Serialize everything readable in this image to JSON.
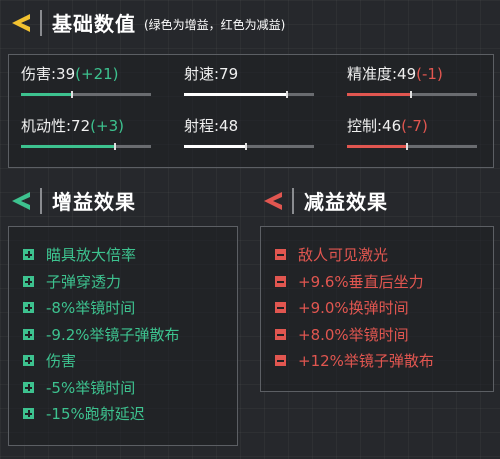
{
  "header": {
    "title": "基础数值",
    "subtitle": "(绿色为增益，红色为减益)"
  },
  "colors": {
    "positive": "#3dc28f",
    "negative": "#e15650",
    "neutral": "#ffffff",
    "accent_yellow": "#f2c230"
  },
  "stats": [
    {
      "label": "伤害:39",
      "delta": "(+21)",
      "delta_type": "positive",
      "fill_fraction": 0.39,
      "prev_fraction": 0.39
    },
    {
      "label": "射速:79",
      "delta": "",
      "delta_type": "none",
      "fill_fraction": 0.79,
      "prev_fraction": 0.79
    },
    {
      "label": "精准度:49",
      "delta": "(-1)",
      "delta_type": "negative",
      "fill_fraction": 0.49,
      "prev_fraction": 0.49
    },
    {
      "label": "机动性:72",
      "delta": "(+3)",
      "delta_type": "positive",
      "fill_fraction": 0.72,
      "prev_fraction": 0.72
    },
    {
      "label": "射程:48",
      "delta": "",
      "delta_type": "none",
      "fill_fraction": 0.48,
      "prev_fraction": 0.48
    },
    {
      "label": "控制:46",
      "delta": "(-7)",
      "delta_type": "negative",
      "fill_fraction": 0.46,
      "prev_fraction": 0.46
    }
  ],
  "buff": {
    "title": "增益效果",
    "items": [
      "瞄具放大倍率",
      "子弹穿透力",
      "-8%举镜时间",
      "-9.2%举镜子弹散布",
      "伤害",
      "-5%举镜时间",
      "-15%跑射延迟"
    ]
  },
  "debuff": {
    "title": "减益效果",
    "items": [
      "敌人可见激光",
      "+9.6%垂直后坐力",
      "+9.0%换弹时间",
      "+8.0%举镜时间",
      "+12%举镜子弹散布"
    ]
  },
  "icons": {
    "base_header": "chevron-left-icon",
    "buff_header": "chevron-left-icon",
    "debuff_header": "chevron-left-icon",
    "buff_bullet": "plus-square-icon",
    "debuff_bullet": "minus-square-icon"
  }
}
